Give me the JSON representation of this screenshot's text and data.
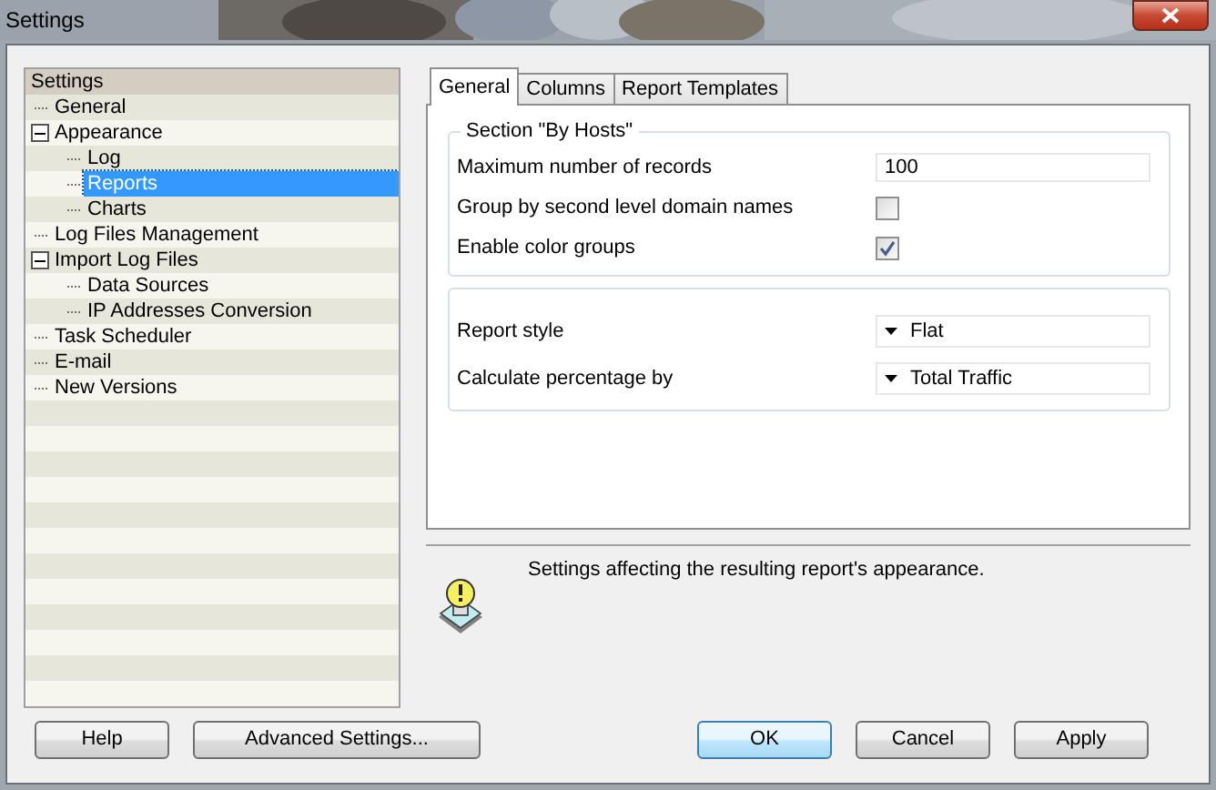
{
  "window": {
    "title": "Settings"
  },
  "tree": {
    "header": "Settings",
    "items": [
      {
        "label": "General",
        "selected": false
      },
      {
        "label": "Appearance",
        "selected": false,
        "expanded": true,
        "children": [
          {
            "label": "Log",
            "selected": false
          },
          {
            "label": "Reports",
            "selected": true
          },
          {
            "label": "Charts",
            "selected": false
          }
        ]
      },
      {
        "label": "Log Files Management",
        "selected": false
      },
      {
        "label": "Import Log Files",
        "selected": false,
        "expanded": true,
        "children": [
          {
            "label": "Data Sources",
            "selected": false
          },
          {
            "label": "IP Addresses Conversion",
            "selected": false
          }
        ]
      },
      {
        "label": "Task Scheduler",
        "selected": false
      },
      {
        "label": "E-mail",
        "selected": false
      },
      {
        "label": "New Versions",
        "selected": false
      }
    ]
  },
  "tabs": [
    {
      "label": "General",
      "selected": true
    },
    {
      "label": "Columns",
      "selected": false
    },
    {
      "label": "Report Templates",
      "selected": false
    }
  ],
  "sections": [
    {
      "title": "Section \"By Hosts\"",
      "rows": [
        {
          "kind": "text",
          "label": "Maximum number of records",
          "value": "100"
        },
        {
          "kind": "checkbox",
          "label": "Group by second level domain names",
          "checked": false
        },
        {
          "kind": "checkbox",
          "label": "Enable color groups",
          "checked": true
        }
      ]
    },
    {
      "rows": [
        {
          "kind": "dropdown",
          "label": "Report style",
          "value": "Flat"
        },
        {
          "kind": "dropdown",
          "label": "Calculate percentage by",
          "value": "Total Traffic"
        }
      ]
    }
  ],
  "hint": "Settings affecting the resulting report's appearance.",
  "buttons": [
    {
      "label": "Help",
      "kind": "normal"
    },
    {
      "label": "Advanced Settings...",
      "kind": "normal"
    },
    {
      "label": "OK",
      "kind": "default"
    },
    {
      "label": "Cancel",
      "kind": "normal"
    },
    {
      "label": "Apply",
      "kind": "normal"
    }
  ]
}
